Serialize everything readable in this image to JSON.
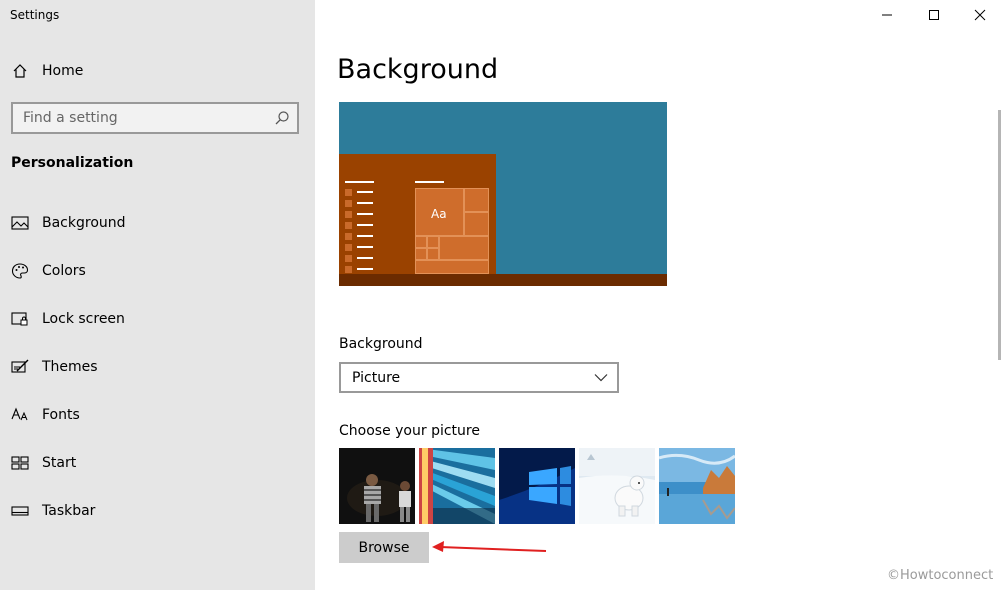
{
  "window": {
    "title": "Settings",
    "controls": [
      "minimize",
      "maximize",
      "close"
    ]
  },
  "sidebar": {
    "home": {
      "label": "Home",
      "icon": "home-icon"
    },
    "search": {
      "placeholder": "Find a setting",
      "value": ""
    },
    "section": "Personalization",
    "items": [
      {
        "label": "Background",
        "icon": "image-icon"
      },
      {
        "label": "Colors",
        "icon": "palette-icon"
      },
      {
        "label": "Lock screen",
        "icon": "lock-screen-icon"
      },
      {
        "label": "Themes",
        "icon": "brush-icon"
      },
      {
        "label": "Fonts",
        "icon": "font-icon"
      },
      {
        "label": "Start",
        "icon": "start-icon"
      },
      {
        "label": "Taskbar",
        "icon": "taskbar-icon"
      }
    ]
  },
  "main": {
    "title": "Background",
    "preview": {
      "tile_text": "Aa",
      "background_color": "#2d7c9a",
      "accent_color": "#9a4200"
    },
    "background_label": "Background",
    "background_value": "Picture",
    "choose_label": "Choose your picture",
    "browse_label": "Browse"
  },
  "watermark": "©Howtoconnect",
  "colors": {
    "sidebar_bg": "#e6e6e6",
    "arrow": "#e02020"
  }
}
